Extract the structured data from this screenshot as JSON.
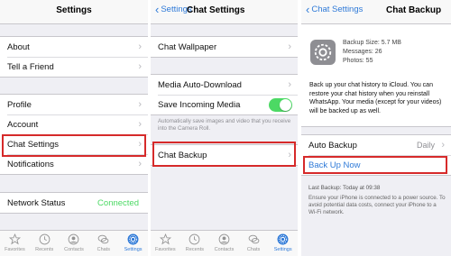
{
  "colors": {
    "accent": "#2f7ad8",
    "highlight": "#d62a2a",
    "green": "#4cd964"
  },
  "panel1": {
    "title": "Settings",
    "group1": [
      {
        "label": "About"
      },
      {
        "label": "Tell a Friend"
      }
    ],
    "group2": [
      {
        "label": "Profile"
      },
      {
        "label": "Account"
      },
      {
        "label": "Chat Settings"
      },
      {
        "label": "Notifications"
      }
    ],
    "network": {
      "label": "Network Status",
      "value": "Connected"
    }
  },
  "panel2": {
    "back": "Settings",
    "title": "Chat Settings",
    "wallpaper": "Chat Wallpaper",
    "auto_download": "Media Auto-Download",
    "save_incoming": "Save Incoming Media",
    "save_incoming_on": true,
    "note": "Automatically save images and video that you receive into the Camera Roll.",
    "chat_backup": "Chat Backup"
  },
  "panel3": {
    "back": "Chat Settings",
    "title": "Chat Backup",
    "backup_size": "Backup Size: 5.7 MB",
    "messages": "Messages: 26",
    "photos": "Photos: 55",
    "description": "Back up your chat history to iCloud. You can restore your chat history when you reinstall WhatsApp. Your media (except for your videos) will be backed up as well.",
    "auto_backup_label": "Auto Backup",
    "auto_backup_value": "Daily",
    "back_up_now": "Back Up Now",
    "last_backup": "Last Backup: Today at 09:38",
    "footer": "Ensure your iPhone is connected to a power source. To avoid potential data costs, connect your iPhone to a Wi-Fi network."
  },
  "tabs": [
    {
      "label": "Favorites",
      "icon": "star-icon"
    },
    {
      "label": "Recents",
      "icon": "clock-icon"
    },
    {
      "label": "Contacts",
      "icon": "person-icon"
    },
    {
      "label": "Chats",
      "icon": "chat-bubbles-icon"
    },
    {
      "label": "Settings",
      "icon": "gear-icon",
      "active": true
    }
  ]
}
